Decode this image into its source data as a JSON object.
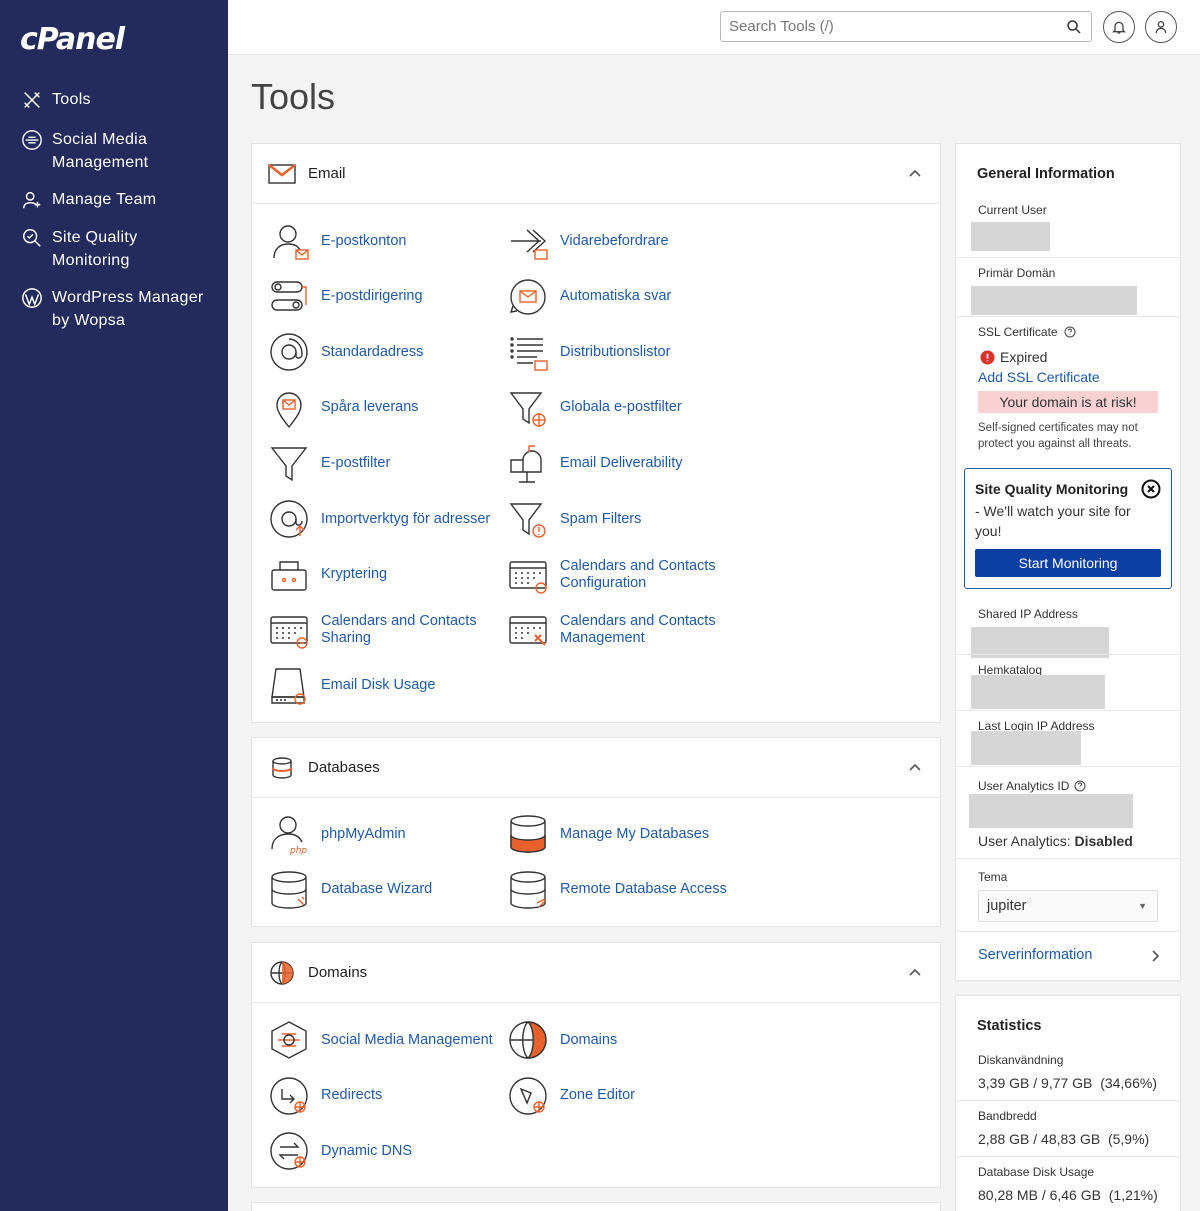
{
  "app": {
    "logo": "cPanel"
  },
  "sidebar": {
    "items": [
      {
        "label": "Tools",
        "icon": "tools-icon"
      },
      {
        "label": "Social Media Management",
        "icon": "social-media-icon"
      },
      {
        "label": "Manage Team",
        "icon": "team-icon"
      },
      {
        "label": "Site Quality Monitoring",
        "icon": "site-quality-icon"
      },
      {
        "label": "WordPress Manager by Wopsa",
        "icon": "wordpress-icon"
      }
    ]
  },
  "topbar": {
    "search_placeholder": "Search Tools (/)"
  },
  "page": {
    "title": "Tools"
  },
  "email": {
    "title": "Email",
    "tools": [
      {
        "label": "E-postkonton",
        "icon": "email-accounts-icon"
      },
      {
        "label": "Vidarebefordrare",
        "icon": "forwarders-icon"
      },
      {
        "label": "E-postdirigering",
        "icon": "email-routing-icon"
      },
      {
        "label": "Automatiska svar",
        "icon": "autoresponders-icon"
      },
      {
        "label": "Standardadress",
        "icon": "default-address-icon"
      },
      {
        "label": "Distributionslistor",
        "icon": "mailing-lists-icon"
      },
      {
        "label": "Spåra leverans",
        "icon": "track-delivery-icon"
      },
      {
        "label": "Globala e-postfilter",
        "icon": "global-filters-icon"
      },
      {
        "label": "E-postfilter",
        "icon": "email-filters-icon"
      },
      {
        "label": "Email Deliverability",
        "icon": "deliverability-icon"
      },
      {
        "label": "Importverktyg för adresser",
        "icon": "address-importer-icon"
      },
      {
        "label": "Spam Filters",
        "icon": "spam-filters-icon"
      },
      {
        "label": "Kryptering",
        "icon": "encryption-icon"
      },
      {
        "label": "Calendars and Contacts Configuration",
        "icon": "calendar-config-icon"
      },
      {
        "label": "Calendars and Contacts Sharing",
        "icon": "calendar-sharing-icon"
      },
      {
        "label": "Calendars and Contacts Management",
        "icon": "calendar-management-icon"
      },
      {
        "label": "Email Disk Usage",
        "icon": "email-disk-usage-icon"
      }
    ]
  },
  "databases": {
    "title": "Databases",
    "tools": [
      {
        "label": "phpMyAdmin",
        "icon": "phpmyadmin-icon"
      },
      {
        "label": "Manage My Databases",
        "icon": "manage-databases-icon"
      },
      {
        "label": "Database Wizard",
        "icon": "database-wizard-icon"
      },
      {
        "label": "Remote Database Access",
        "icon": "remote-database-icon"
      }
    ]
  },
  "domains": {
    "title": "Domains",
    "tools": [
      {
        "label": "Social Media Management",
        "icon": "social-media-management-icon"
      },
      {
        "label": "Domains",
        "icon": "domains-icon"
      },
      {
        "label": "Redirects",
        "icon": "redirects-icon"
      },
      {
        "label": "Zone Editor",
        "icon": "zone-editor-icon"
      },
      {
        "label": "Dynamic DNS",
        "icon": "dynamic-dns-icon"
      }
    ]
  },
  "general_info": {
    "title": "General Information",
    "current_user_label": "Current User",
    "primary_domain_label": "Primär Domän",
    "ssl_label": "SSL Certificate",
    "ssl_status": "Expired",
    "add_ssl": "Add SSL Certificate",
    "risk_text": "Your domain is at risk!",
    "warning_text": "Self-signed certificates may not protect you against all threats.",
    "sqm_title": "Site Quality Monitoring",
    "sqm_desc": "- We'll watch your site for you!",
    "sqm_button": "Start Monitoring",
    "shared_ip_label": "Shared IP Address",
    "home_dir_label": "Hemkatalog",
    "last_login_label": "Last Login IP Address",
    "analytics_id_label": "User Analytics ID",
    "analytics_prefix": "User Analytics:",
    "analytics_value": "Disabled",
    "theme_label": "Tema",
    "theme_value": "jupiter",
    "server_info": "Serverinformation"
  },
  "statistics": {
    "title": "Statistics",
    "items": [
      {
        "label": "Diskanvändning",
        "value": "3,39 GB / 9,77 GB",
        "percent": "(34,66%)"
      },
      {
        "label": "Bandbredd",
        "value": "2,88 GB / 48,83 GB",
        "percent": "(5,9%)"
      },
      {
        "label": "Database Disk Usage",
        "value": "80,28 MB / 6,46 GB",
        "percent": "(1,21%)"
      }
    ]
  },
  "colors": {
    "sidebar": "#232a5c",
    "link": "#1f5aa6",
    "accent": "#e8612c",
    "button": "#0b3fa3"
  }
}
